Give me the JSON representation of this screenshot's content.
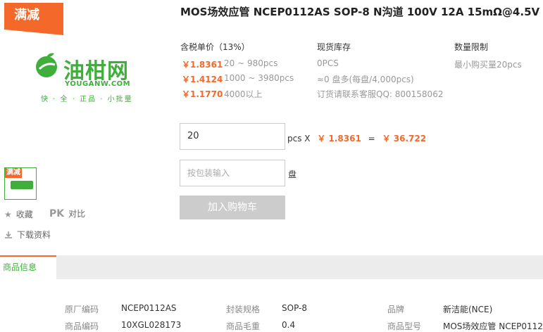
{
  "promo": {
    "label": "满减"
  },
  "logo": {
    "brand": "油柑网",
    "domain": "YOUGANW.COM",
    "slogan": "快 · 全 · 正品 · 小批量"
  },
  "thumb": {
    "badge": "满减"
  },
  "actions": {
    "favorite": "收藏",
    "pk_badge": "PK",
    "compare": "对比",
    "download": "下载资料"
  },
  "product": {
    "title": "MOS场效应管 NCEP0112AS SOP-8 N沟道 100V 12A 15mΩ@4.5V"
  },
  "pricing": {
    "header": "含税单价（13%）",
    "tiers": [
      {
        "price": "￥1.8361",
        "range": "20 ~ 980pcs"
      },
      {
        "price": "￥1.4124",
        "range": "1000 ~ 3980pcs"
      },
      {
        "price": "￥1.1770",
        "range": "4000以上"
      }
    ]
  },
  "stock": {
    "header": "现货库存",
    "qty": "0PCS",
    "reel": "≈0 盘多(每盘/4,000pcs)",
    "contact": "订货请联系客服QQ: 800158062"
  },
  "limit": {
    "header": "数量限制",
    "min": "最小购买量20pcs"
  },
  "order": {
    "qty_value": "20",
    "unit": "pcs X",
    "unit_price": "￥ 1.8361",
    "equals": "=",
    "total": "￥ 36.722",
    "pack_placeholder": "按包装输入",
    "pack_unit": "盘",
    "add_cart": "加入购物车"
  },
  "tabs": {
    "active": "商品信息"
  },
  "specs": {
    "rows": [
      [
        {
          "label": "原厂编码",
          "value": "NCEP0112AS"
        },
        {
          "label": "封装规格",
          "value": "SOP-8"
        },
        {
          "label": "品牌",
          "value": "新洁能(NCE)"
        }
      ],
      [
        {
          "label": "商品编码",
          "value": "10XGL028173"
        },
        {
          "label": "商品毛重",
          "value": "0.4"
        },
        {
          "label": "商品型号",
          "value": "MOS场效应管 NCEP0112..."
        }
      ]
    ]
  },
  "colors": {
    "accent": "#f4682a",
    "brand_green": "#3fae3a",
    "disabled": "#cccccc"
  }
}
